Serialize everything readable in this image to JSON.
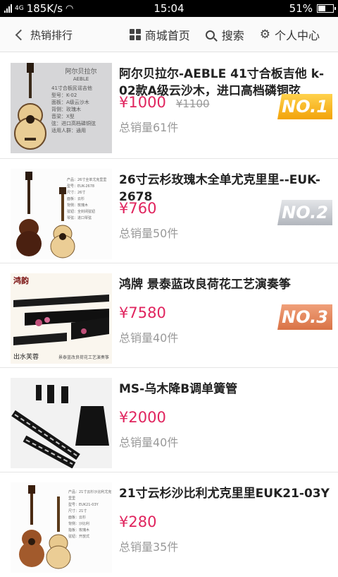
{
  "status": {
    "network": "4G",
    "speed": "185K/s",
    "time": "15:04",
    "battery": "51%",
    "battery_level": 0.51
  },
  "nav": {
    "back_label": "热销排行",
    "home_label": "商城首页",
    "search_label": "搜索",
    "profile_label": "个人中心"
  },
  "products": [
    {
      "title": "阿尔贝拉尔-AEBLE 41寸合板吉他 k-02款A级云沙木，进口高档磷铜弦",
      "price": "¥1000",
      "old_price": "¥1100",
      "sales": "总销量61件",
      "rank": "NO.1",
      "thumb": {
        "brand": "阿尔贝拉尔",
        "brand_en": "AEBLE",
        "specs": [
          "41寸合板民谣吉他",
          "型号：K-02",
          "面板：A级云沙木",
          "背侧：玫瑰木",
          "音梁：X型",
          "弦：进口高档磷铜弦",
          "适用人群：通用"
        ]
      }
    },
    {
      "title": "26寸云杉玫瑰木全单尤克里里--EUK-2678",
      "price": "¥760",
      "old_price": "",
      "sales": "总销量50件",
      "rank": "NO.2",
      "thumb": {
        "specs": [
          "产品：26寸全单尤克里里",
          "型号：EUK-2678",
          "尺寸：26寸",
          "面板：云杉",
          "背侧：玫瑰木",
          "弦钮：全封闭弦钮",
          "琴弦：进口琴弦"
        ]
      }
    },
    {
      "title": "鸿牌 景泰蓝改良荷花工艺演奏筝",
      "price": "¥7580",
      "old_price": "",
      "sales": "总销量40件",
      "rank": "NO.3",
      "thumb": {
        "brand": "鸿韵",
        "bottom_left": "出水芙蓉",
        "bottom_right": "景泰蓝改良荷花工艺演奏筝"
      }
    },
    {
      "title": "MS-乌木降B调单簧管",
      "price": "¥2000",
      "old_price": "",
      "sales": "总销量40件",
      "rank": ""
    },
    {
      "title": "21寸云杉沙比利尤克里里EUK21-03Y",
      "price": "¥280",
      "old_price": "",
      "sales": "总销量35件",
      "rank": "",
      "thumb": {
        "specs": [
          "产品：21寸云杉沙比利尤克里里",
          "型号：EUK21-03Y",
          "尺寸：21寸",
          "面板：云杉",
          "背侧：沙比利",
          "指板：玫瑰木",
          "弦钮：开放式"
        ]
      }
    }
  ],
  "colors": {
    "price": "#e0245e",
    "rank1": "#f2a30a",
    "rank2": "#b2b6bd",
    "rank3": "#d97346"
  }
}
